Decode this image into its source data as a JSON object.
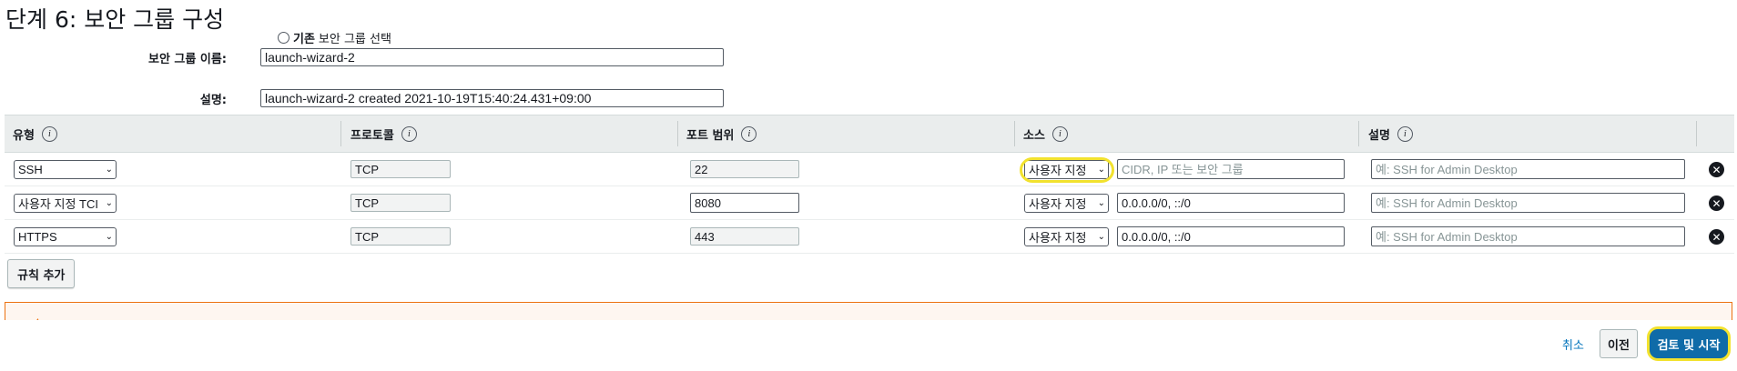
{
  "page": {
    "title": "단계 6: 보안 그룹 구성"
  },
  "radio": {
    "strong_label": "기존",
    "label": "보안 그룹 선택"
  },
  "form": {
    "name_label": "보안 그룹 이름:",
    "name_value": "launch-wizard-2",
    "desc_label": "설명:",
    "desc_value": "launch-wizard-2 created 2021-10-19T15:40:24.431+09:00"
  },
  "table": {
    "columns": [
      "유형",
      "프로토콜",
      "포트 범위",
      "소스",
      "설명"
    ],
    "info_glyph": "i",
    "remove_glyph": "✕",
    "chevron": "⌄",
    "rows": [
      {
        "type": "SSH",
        "protocol": "TCP",
        "port": "22",
        "source_select": "사용자 지정",
        "source_value": "",
        "source_placeholder": "CIDR, IP 또는 보안 그룹",
        "desc_value": "",
        "desc_placeholder": "예: SSH for Admin Desktop"
      },
      {
        "type": "사용자 지정 TCI",
        "protocol": "TCP",
        "port": "8080",
        "source_select": "사용자 지정",
        "source_value": "0.0.0.0/0, ::/0",
        "source_placeholder": "",
        "desc_value": "",
        "desc_placeholder": "예: SSH for Admin Desktop"
      },
      {
        "type": "HTTPS",
        "protocol": "TCP",
        "port": "443",
        "source_select": "사용자 지정",
        "source_value": "0.0.0.0/0, ::/0",
        "source_placeholder": "",
        "desc_value": "",
        "desc_placeholder": "예: SSH for Admin Desktop"
      }
    ]
  },
  "buttons": {
    "add_rule": "규칙 추가",
    "cancel": "취소",
    "previous": "이전",
    "review_launch": "검토 및 시작"
  },
  "colors": {
    "highlight": "#f2e22e",
    "primary": "#0f6ba8",
    "link": "#0073bb",
    "warning": "#ec7211",
    "header_bg": "#eaeded"
  }
}
